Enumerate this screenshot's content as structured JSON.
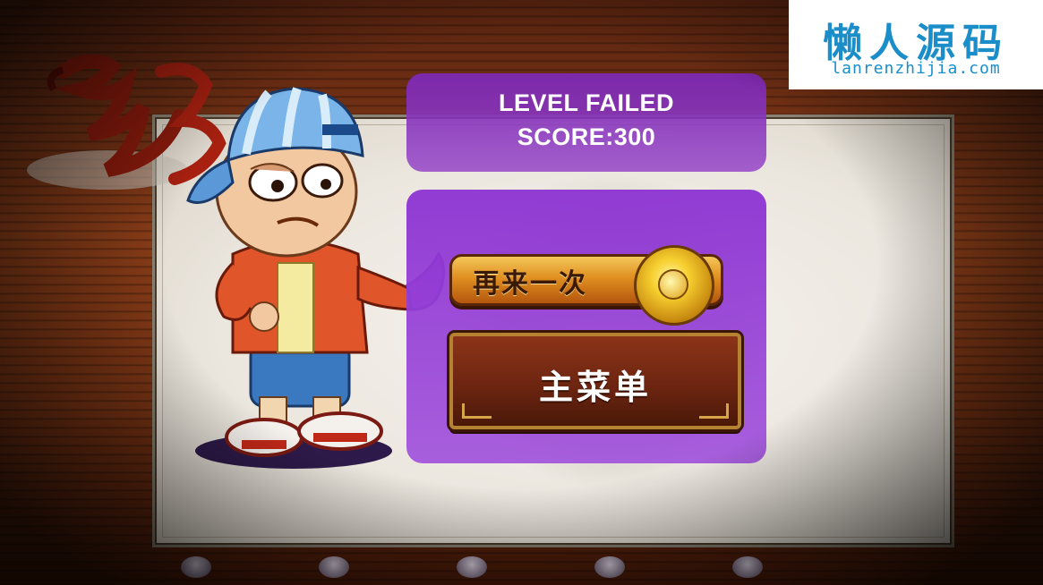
{
  "result": {
    "title": "LEVEL FAILED",
    "score_text": "SCORE:300"
  },
  "buttons": {
    "retry_label": "再来一次",
    "main_menu_label": "主菜单"
  },
  "logo": {
    "text": "修仙"
  },
  "watermark": {
    "title": "懒人源码",
    "url": "lanrenzhijia.com"
  },
  "colors": {
    "panel_purple": "#8c32d2",
    "button_gold": "#e08f20",
    "button_brown": "#6a2410",
    "watermark_blue": "#1b8ec9"
  }
}
